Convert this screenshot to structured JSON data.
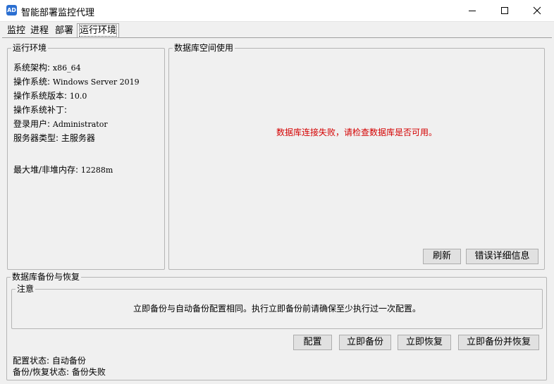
{
  "window": {
    "title": "智能部署监控代理",
    "icon_text": "AD"
  },
  "tabs": [
    {
      "label": "监控"
    },
    {
      "label": "进程"
    },
    {
      "label": "部署"
    },
    {
      "label": "运行环境",
      "active": true
    }
  ],
  "env": {
    "title": "运行环境",
    "arch_label": "系统架构:",
    "arch_value": "x86_64",
    "os_label": "操作系统:",
    "os_value": "Windows Server 2019",
    "os_version_label": "操作系统版本:",
    "os_version_value": "10.0",
    "os_patch_label": "操作系统补丁:",
    "user_label": "登录用户:",
    "user_value": "Administrator",
    "server_type_label": "服务器类型:",
    "server_type_value": "主服务器",
    "heap_label": "最大堆/非堆内存:",
    "heap_value": "12288m"
  },
  "db_space": {
    "title": "数据库空间使用",
    "error": "数据库连接失败，请检查数据库是否可用。",
    "refresh_label": "刷新",
    "error_detail_label": "错误详细信息"
  },
  "backup": {
    "title": "数据库备份与恢复",
    "notice_title": "注意",
    "notice_text": "立即备份与自动备份配置相同。执行立即备份前请确保至少执行过一次配置。",
    "config_label": "配置",
    "backup_now_label": "立即备份",
    "restore_now_label": "立即恢复",
    "backup_restore_label": "立即备份并恢复",
    "config_status": "配置状态: 自动备份",
    "backup_status": "备份/恢复状态: 备份失败"
  },
  "colors": {
    "error_text": "#d40000",
    "app_icon": "#2b6fd1"
  }
}
